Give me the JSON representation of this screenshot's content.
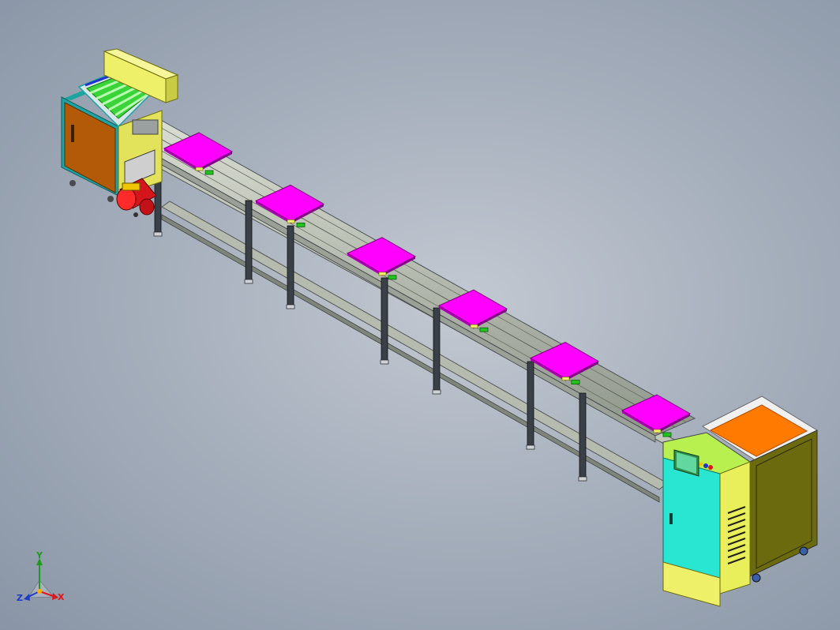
{
  "colors": {
    "background_center": "#c3c9d2",
    "background_edge": "#8995a6",
    "frame_rail": "#b7bdb0",
    "frame_dark": "#3a4047",
    "pallet_top": "#ff00ff",
    "pallet_side": "#b000b8",
    "sensor_green": "#22c31f",
    "accent_yellow": "#eef06a",
    "panel_orange": "#ff7a00",
    "cabinet_teal": "#28e6d2",
    "cabinet_olive": "#6b6a0e",
    "roller_green": "#5ee84a",
    "motor_red": "#e0161c",
    "door_brown": "#b25a07",
    "frame_cyan": "#1ea3a3"
  },
  "triad": {
    "x_label": "X",
    "y_label": "Y",
    "z_label": "Z",
    "x_color": "#e0161c",
    "y_color": "#1f9a1f",
    "z_color": "#1e3bc8"
  },
  "assemblies": [
    {
      "name": "loading-station",
      "icon": "roller-conveyor-icon"
    },
    {
      "name": "drive-motor",
      "icon": "motor-icon"
    },
    {
      "name": "pallet-conveyor-line",
      "icon": "conveyor-icon",
      "pallet_count": 6,
      "leg_pairs": 4
    },
    {
      "name": "control-cabinet",
      "icon": "hmi-screen-icon"
    }
  ]
}
